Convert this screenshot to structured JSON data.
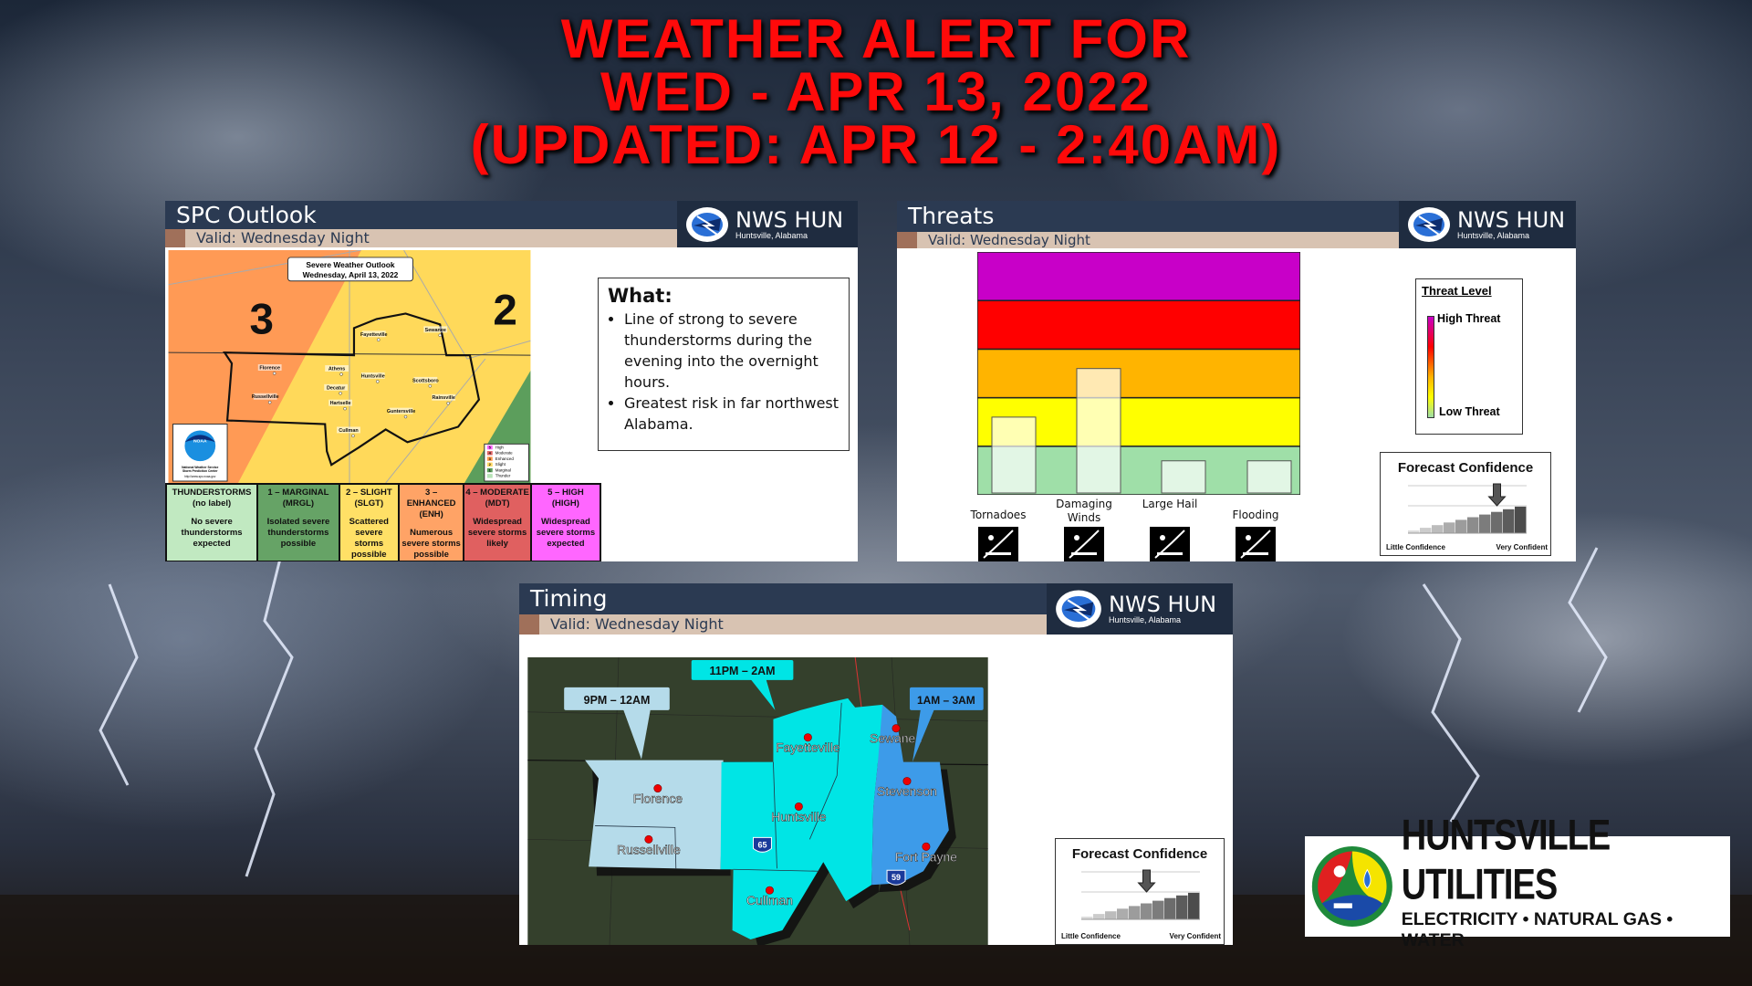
{
  "title": {
    "line1": "WEATHER ALERT FOR",
    "line2": "WED - APR 13, 2022",
    "line3": "(UPDATED: APR 12 - 2:40AM)",
    "color": "#ff0a0a"
  },
  "nws": {
    "name": "NWS HUN",
    "location": "Huntsville, Alabama",
    "logo_text": "NATIONAL WEATHER SERVICE"
  },
  "spc": {
    "title": "SPC Outlook",
    "valid": "Valid: Wednesday Night",
    "map": {
      "header_line1": "Severe Weather Outlook",
      "header_line2": "Wednesday, April 13, 2022",
      "risk_left": "3",
      "risk_right": "2",
      "noaa_text": "NOAA",
      "noaa_line1": "National Weather Service",
      "noaa_line2": "Storm Prediction Center",
      "noaa_url": "http://www.spc.noaa.gov",
      "cities": [
        "Florence",
        "Russellville",
        "Athens",
        "Huntsville",
        "Decatur",
        "Hartselle",
        "Cullman",
        "Fayetteville",
        "Sewanee",
        "Scottsboro",
        "Rainsville",
        "Guntersville"
      ],
      "legend": [
        {
          "num": "5",
          "label": "High",
          "color": "#ff66ff"
        },
        {
          "num": "4",
          "label": "Moderate",
          "color": "#e06666"
        },
        {
          "num": "3",
          "label": "Enhanced",
          "color": "#ff9a4d"
        },
        {
          "num": "2",
          "label": "Slight",
          "color": "#ffd966"
        },
        {
          "num": "1",
          "label": "Marginal",
          "color": "#5c9e5c"
        },
        {
          "num": "",
          "label": "Thunder",
          "color": "#b6e3b6"
        }
      ]
    },
    "categories": [
      {
        "name": "THUNDERSTORMS",
        "abbr": "(no label)",
        "desc": "No severe thunderstorms expected",
        "color": "#c1e9c1"
      },
      {
        "name": "1 – MARGINAL",
        "abbr": "(MRGL)",
        "desc": "Isolated severe thunderstorms possible",
        "color": "#66a366"
      },
      {
        "name": "2 – SLIGHT",
        "abbr": "(SLGT)",
        "desc": "Scattered severe storms possible",
        "color": "#ffe066"
      },
      {
        "name": "3 – ENHANCED",
        "abbr": "(ENH)",
        "desc": "Numerous severe storms possible",
        "color": "#ffa366"
      },
      {
        "name": "4 – MODERATE",
        "abbr": "(MDT)",
        "desc": "Widespread severe storms likely",
        "color": "#e06060"
      },
      {
        "name": "5 – HIGH",
        "abbr": "(HIGH)",
        "desc": "Widespread severe storms expected",
        "color": "#ff66ff"
      }
    ],
    "what": {
      "heading": "What:",
      "bullets": [
        "Line of strong to severe thunderstorms during the evening into the overnight hours.",
        "Greatest risk in far northwest Alabama."
      ]
    }
  },
  "threats": {
    "title": "Threats",
    "valid": "Valid: Wednesday Night",
    "band_colors": [
      "#9fdfa8",
      "#ffff00",
      "#ffb400",
      "#ff0000",
      "#c800c8"
    ],
    "items": [
      {
        "label": "Tornadoes",
        "level": 1.6,
        "icon": "tornado-icon"
      },
      {
        "label": "Damaging Winds",
        "level": 2.6,
        "icon": "wind-tree-icon"
      },
      {
        "label": "Large Hail",
        "level": 0.7,
        "icon": "hail-icon"
      },
      {
        "label": "Flooding",
        "level": 0.7,
        "icon": "flooded-car-icon"
      }
    ],
    "level_max": 5,
    "legend": {
      "title": "Threat Level",
      "high": "High Threat",
      "low": "Low Threat"
    },
    "confidence": {
      "title": "Forecast Confidence",
      "low": "Little Confidence",
      "high": "Very Confident",
      "level": 8,
      "max": 10
    }
  },
  "timing": {
    "title": "Timing",
    "valid": "Valid: Wednesday Night",
    "windows": [
      "9PM – 12AM",
      "11PM – 2AM",
      "1AM – 3AM"
    ],
    "colors": [
      "#b5dbea",
      "#00e5e5",
      "#3d9be9"
    ],
    "cities": [
      "Florence",
      "Russellville",
      "Huntsville",
      "Fayetteville",
      "Sewanee",
      "Stevenson",
      "Fort Payne",
      "Cullman"
    ],
    "interstates": [
      "65",
      "59"
    ],
    "confidence": {
      "title": "Forecast Confidence",
      "low": "Little Confidence",
      "high": "Very Confident",
      "level": 6,
      "max": 10
    }
  },
  "sponsor": {
    "name": "HUNTSVILLE UTILITIES",
    "tagline": "ELECTRICITY • NATURAL GAS • WATER"
  }
}
